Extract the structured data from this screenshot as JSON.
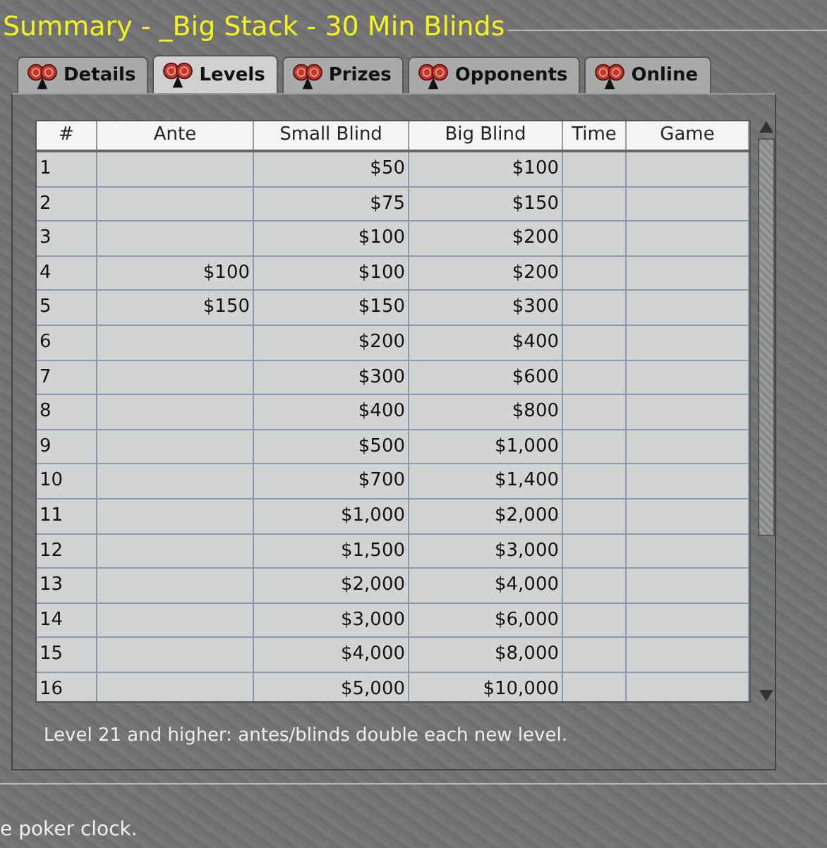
{
  "title": "Summary - _Big Stack - 30 Min Blinds",
  "tabs": [
    {
      "label": "Details",
      "selected": false
    },
    {
      "label": "Levels",
      "selected": true
    },
    {
      "label": "Prizes",
      "selected": false
    },
    {
      "label": "Opponents",
      "selected": false
    },
    {
      "label": "Online",
      "selected": false
    }
  ],
  "table": {
    "columns": [
      "#",
      "Ante",
      "Small Blind",
      "Big Blind",
      "Time",
      "Game"
    ],
    "rows": [
      [
        "1",
        "",
        "$50",
        "$100",
        "",
        ""
      ],
      [
        "2",
        "",
        "$75",
        "$150",
        "",
        ""
      ],
      [
        "3",
        "",
        "$100",
        "$200",
        "",
        ""
      ],
      [
        "4",
        "$100",
        "$100",
        "$200",
        "",
        ""
      ],
      [
        "5",
        "$150",
        "$150",
        "$300",
        "",
        ""
      ],
      [
        "6",
        "",
        "$200",
        "$400",
        "",
        ""
      ],
      [
        "7",
        "",
        "$300",
        "$600",
        "",
        ""
      ],
      [
        "8",
        "",
        "$400",
        "$800",
        "",
        ""
      ],
      [
        "9",
        "",
        "$500",
        "$1,000",
        "",
        ""
      ],
      [
        "10",
        "",
        "$700",
        "$1,400",
        "",
        ""
      ],
      [
        "11",
        "",
        "$1,000",
        "$2,000",
        "",
        ""
      ],
      [
        "12",
        "",
        "$1,500",
        "$3,000",
        "",
        ""
      ],
      [
        "13",
        "",
        "$2,000",
        "$4,000",
        "",
        ""
      ],
      [
        "14",
        "",
        "$3,000",
        "$6,000",
        "",
        ""
      ],
      [
        "15",
        "",
        "$4,000",
        "$8,000",
        "",
        ""
      ],
      [
        "16",
        "",
        "$5,000",
        "$10,000",
        "",
        ""
      ]
    ]
  },
  "note": "Level 21 and higher: antes/blinds double each new level.",
  "status": "e poker clock."
}
